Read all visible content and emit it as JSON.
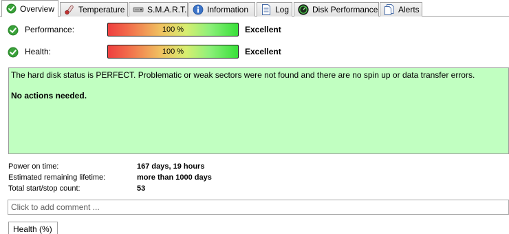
{
  "tabs": [
    {
      "label": "Overview",
      "icon": "check-circle-icon",
      "active": true
    },
    {
      "label": "Temperature",
      "icon": "thermometer-icon",
      "active": false
    },
    {
      "label": "S.M.A.R.T.",
      "icon": "hard-disk-icon",
      "active": false
    },
    {
      "label": "Information",
      "icon": "info-icon",
      "active": false
    },
    {
      "label": "Log",
      "icon": "document-icon",
      "active": false
    },
    {
      "label": "Disk Performance",
      "icon": "gauge-icon",
      "active": false
    },
    {
      "label": "Alerts",
      "icon": "alert-document-icon",
      "active": false
    }
  ],
  "performance": {
    "label": "Performance:",
    "percent_text": "100 %",
    "fraction": 1.0,
    "rating": "Excellent"
  },
  "health": {
    "label": "Health:",
    "percent_text": "100 %",
    "fraction": 1.0,
    "rating": "Excellent"
  },
  "status": {
    "message": "The hard disk status is PERFECT. Problematic or weak sectors were not found and there are no spin up or data transfer errors.",
    "action": "No actions needed."
  },
  "info": {
    "power_on_label": "Power on time:",
    "power_on_value": "167 days, 19 hours",
    "lifetime_label": "Estimated remaining lifetime:",
    "lifetime_value": "more than 1000 days",
    "startstop_label": "Total start/stop count:",
    "startstop_value": "53"
  },
  "comment": {
    "placeholder": "Click to add comment ..."
  },
  "bottom_tab": {
    "label": "Health (%)"
  },
  "colors": {
    "status_background": "#c1ffc1",
    "ok_green": "#2e9e2e"
  }
}
